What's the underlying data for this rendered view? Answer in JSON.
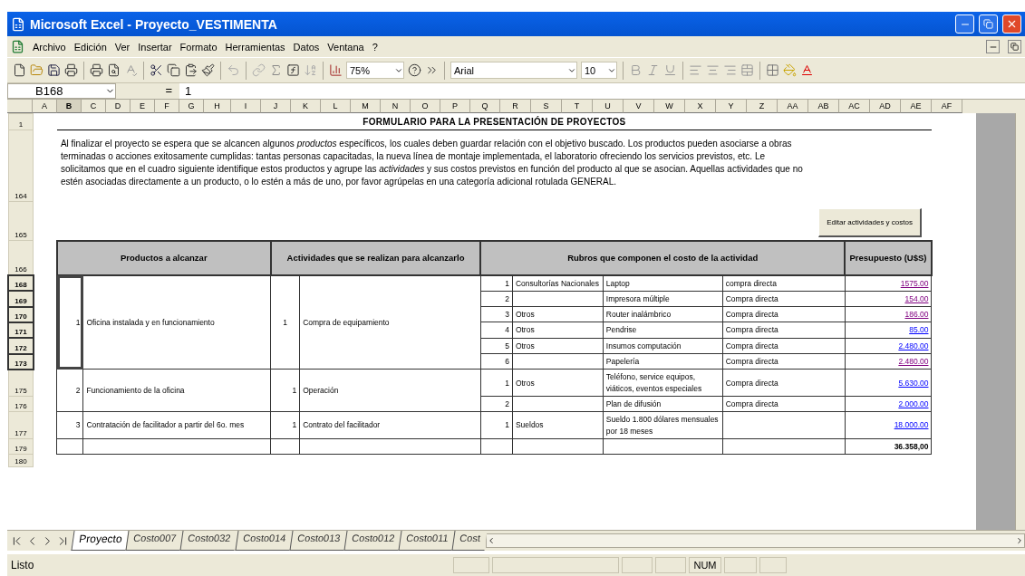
{
  "window": {
    "title": "Microsoft Excel - Proyecto_VESTIMENTA"
  },
  "menu": [
    "Archivo",
    "Edición",
    "Ver",
    "Insertar",
    "Formato",
    "Herramientas",
    "Datos",
    "Ventana",
    "?"
  ],
  "toolbar": {
    "zoom": "75%",
    "font": "Arial",
    "font_size": "10"
  },
  "formula_bar": {
    "name_box": "B168",
    "equals": "=",
    "value": "1"
  },
  "sheet": {
    "columns": [
      {
        "label": "A",
        "selected": false
      },
      {
        "label": "B",
        "selected": true
      },
      {
        "label": "C",
        "selected": false
      },
      {
        "label": "D",
        "selected": false
      },
      {
        "label": "E",
        "selected": false
      },
      {
        "label": "F",
        "selected": false
      },
      {
        "label": "G",
        "selected": false
      },
      {
        "label": "H",
        "selected": false
      },
      {
        "label": "I",
        "selected": false
      },
      {
        "label": "J",
        "selected": false
      },
      {
        "label": "K",
        "selected": false
      },
      {
        "label": "L",
        "selected": false
      },
      {
        "label": "M",
        "selected": false
      },
      {
        "label": "N",
        "selected": false
      },
      {
        "label": "O",
        "selected": false
      },
      {
        "label": "P",
        "selected": false
      },
      {
        "label": "Q",
        "selected": false
      },
      {
        "label": "R",
        "selected": false
      },
      {
        "label": "S",
        "selected": false
      },
      {
        "label": "T",
        "selected": false
      },
      {
        "label": "U",
        "selected": false
      },
      {
        "label": "V",
        "selected": false
      },
      {
        "label": "W",
        "selected": false
      },
      {
        "label": "X",
        "selected": false
      },
      {
        "label": "Y",
        "selected": false
      },
      {
        "label": "Z",
        "selected": false
      },
      {
        "label": "AA",
        "selected": false
      },
      {
        "label": "AB",
        "selected": false
      },
      {
        "label": "AC",
        "selected": false
      },
      {
        "label": "AD",
        "selected": false
      },
      {
        "label": "AE",
        "selected": false
      },
      {
        "label": "AF",
        "selected": false
      }
    ],
    "title_row": {
      "row": {
        "label": "1",
        "selected": false
      },
      "text": "FORMULARIO PARA LA PRESENTACIÓN DE PROYECTOS"
    },
    "intro_row": {
      "row": {
        "label": "164",
        "selected": false
      },
      "text": "Al finalizar el proyecto se espera que se alcancen algunos *productos* específicos, los cuales deben guardar relación con el objetivo buscado. Los productos pueden asociarse a obras terminadas o acciones exitosamente cumplidas: tantas personas capacitadas, la nueva línea de montaje implementada, el laboratorio ofreciendo los servicios previstos, etc. Le solicitamos que en el cuadro siguiente identifique estos productos y agrupe las *actividades* y sus costos previstos en función del producto al que se asocian. Aquellas actividades que no estén asociadas directamente a un producto, o lo estén a más de uno, por favor agrúpelas en una categoría adicional rotulada GENERAL."
    },
    "button_row": {
      "row": {
        "label": "165",
        "selected": false
      },
      "button": "Editar actividades y costos"
    },
    "header_row": {
      "row": {
        "label": "166",
        "selected": false
      },
      "headers": [
        "Productos a alcanzar",
        "Actividades que se realizan para alcanzarlo",
        "Rubros que componen el costo de la actividad",
        "Presupuesto (U$S)"
      ]
    },
    "products": [
      {
        "number": "1",
        "name": "Oficina instalada y en funcionamiento",
        "active": true,
        "activities": [
          {
            "number": "1",
            "name": "Compra de equipamiento",
            "rubros": [
              {
                "row": {
                  "label": "168",
                  "selected": true
                },
                "number": "1",
                "category": "Consultorías Nacionales",
                "item": "Laptop",
                "type": "compra directa",
                "amount": "1575.00",
                "visited": true
              },
              {
                "row": {
                  "label": "169",
                  "selected": true
                },
                "number": "2",
                "item": "Impresora múltiple",
                "type": "Compra directa",
                "amount": "154.00",
                "visited": true
              },
              {
                "row": {
                  "label": "170",
                  "selected": true
                },
                "number": "3",
                "category": "Otros",
                "item": "Router inalámbrico",
                "type": "Compra directa",
                "amount": "186.00",
                "visited": true
              },
              {
                "row": {
                  "label": "171",
                  "selected": true
                },
                "number": "4",
                "category": "Otros",
                "item": "Pendrise",
                "type": "Compra directa",
                "amount": "85.00",
                "visited": false
              },
              {
                "row": {
                  "label": "172",
                  "selected": true
                },
                "number": "5",
                "category": "Otros",
                "item": "Insumos computación",
                "type": "Compra directa",
                "amount": "2.480.00",
                "visited": false
              },
              {
                "row": {
                  "label": "173",
                  "selected": true
                },
                "number": "6",
                "item": "Papelería",
                "type": "Compra directa",
                "amount": "2.480.00",
                "visited": true
              }
            ]
          }
        ]
      },
      {
        "number": "2",
        "name": "Funcionamiento de la oficina",
        "active": false,
        "activities": [
          {
            "number": "1",
            "name": "Operación",
            "rubros": [
              {
                "row": {
                  "label": "175",
                  "selected": false
                },
                "number": "1",
                "category": "Otros",
                "item": "Teléfono, service equipos, viáticos, eventos especiales",
                "type": "Compra directa",
                "amount": "5.630.00",
                "visited": false
              },
              {
                "row": {
                  "label": "176",
                  "selected": false
                },
                "number": "2",
                "item": "Plan de difusión",
                "type": "Compra directa",
                "amount": "2.000.00",
                "visited": false
              }
            ]
          }
        ]
      },
      {
        "number": "3",
        "name": "Contratación de facilitador a partir del 6o. mes",
        "active": false,
        "activities": [
          {
            "number": "1",
            "name": "Contrato del facilitador",
            "rubros": [
              {
                "row": {
                  "label": "177",
                  "selected": false
                },
                "number": "1",
                "category": "Sueldos",
                "item": "Sueldo 1.800 dólares mensuales por 18 meses",
                "amount": "18.000.00",
                "visited": false
              }
            ]
          }
        ]
      }
    ],
    "total_row": {
      "row": {
        "label": "179",
        "selected": false
      },
      "total": "36.358,00"
    },
    "blank_rows": [
      {
        "label": "180",
        "selected": false
      }
    ]
  },
  "sheet_tabs": [
    {
      "label": "Proyecto",
      "selected": true
    },
    {
      "label": "Costo007",
      "selected": false
    },
    {
      "label": "Costo032",
      "selected": false
    },
    {
      "label": "Costo014",
      "selected": false
    },
    {
      "label": "Costo013",
      "selected": false
    },
    {
      "label": "Costo012",
      "selected": false
    },
    {
      "label": "Costo011",
      "selected": false
    },
    {
      "label": "Cost",
      "selected": false
    }
  ],
  "status_bar": {
    "message": "Listo",
    "indicators": [
      "NUM"
    ]
  }
}
